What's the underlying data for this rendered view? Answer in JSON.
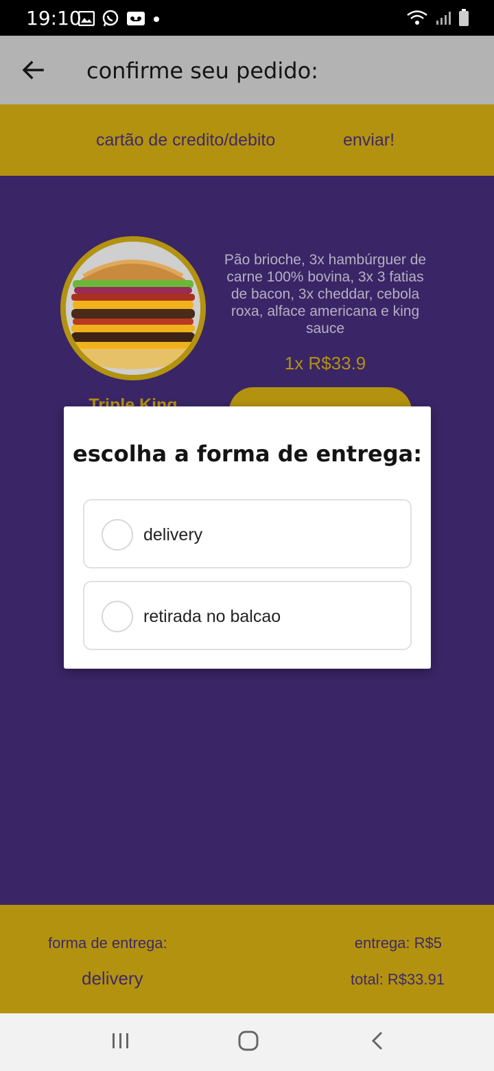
{
  "status_bar": {
    "time": "19:10"
  },
  "app_bar": {
    "title": "confirme seu pedido:"
  },
  "actions": {
    "payment_label": "cartão de credito/debito",
    "send_label": "enviar!"
  },
  "product": {
    "name": "Triple King",
    "description": "Pão brioche, 3x hambúrguer de carne 100% bovina, 3x 3 fatias de bacon, 3x cheddar, cebola roxa, alface americana e king sauce",
    "price": "1x R$33.9"
  },
  "modal": {
    "title": "escolha a forma de entrega:",
    "options": [
      {
        "label": "delivery",
        "selected": false
      },
      {
        "label": "retirada no balcao",
        "selected": false
      }
    ]
  },
  "footer": {
    "delivery_label": "forma de entrega:",
    "delivery_value": "delivery",
    "fee": "entrega: R$5",
    "total": "total: R$33.91"
  },
  "colors": {
    "accent": "#b39210",
    "background": "#3a2566",
    "app_bar": "#b3b3b3"
  },
  "icons": {
    "status_left": [
      "gallery-icon",
      "whatsapp-icon",
      "voicemail-icon",
      "dot-icon"
    ],
    "status_right": [
      "wifi-icon",
      "signal-icon",
      "battery-icon"
    ],
    "nav": [
      "recents-icon",
      "home-icon",
      "back-icon"
    ]
  }
}
